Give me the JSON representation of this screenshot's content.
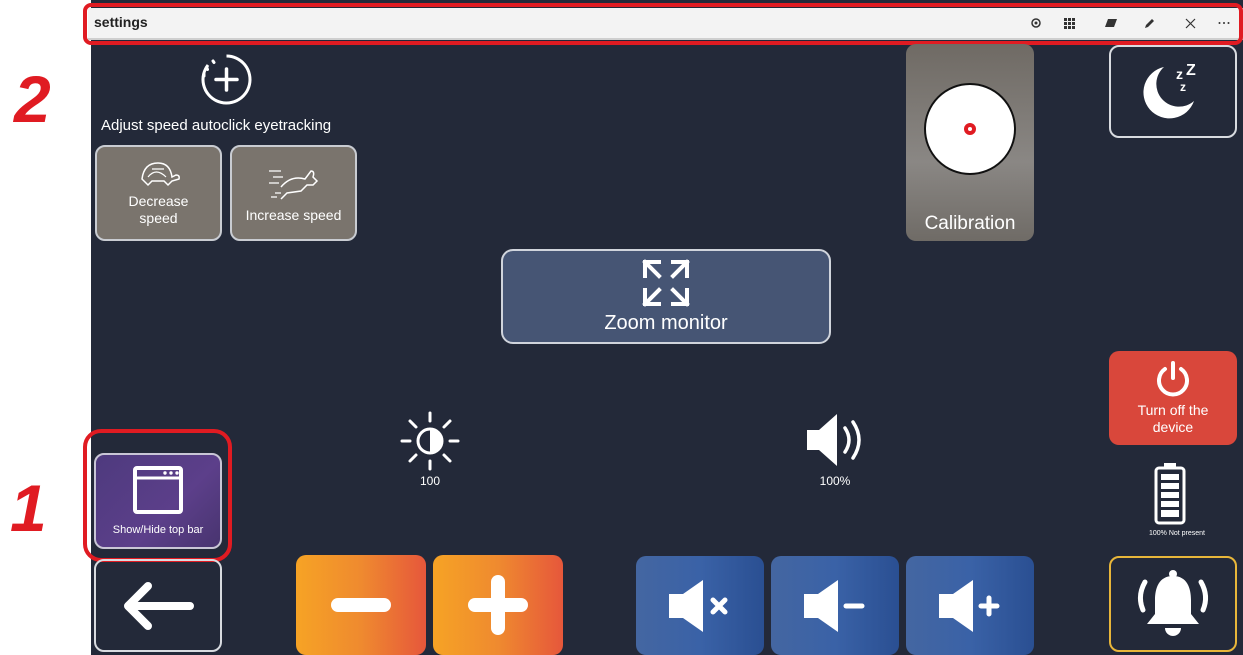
{
  "window": {
    "title": "settings"
  },
  "annotations": {
    "marker_1": "1",
    "marker_2": "2"
  },
  "speed": {
    "heading": "Adjust speed autoclick eyetracking",
    "decrease_label_line1": "Decrease",
    "decrease_label_line2": "speed",
    "increase_label": "Increase speed"
  },
  "calibration": {
    "label": "Calibration"
  },
  "zoom": {
    "label": "Zoom monitor"
  },
  "brightness": {
    "value": "100"
  },
  "volume": {
    "value": "100%"
  },
  "power": {
    "label_line1": "Turn off the",
    "label_line2": "device"
  },
  "battery": {
    "status": "100% Not present",
    "level": 1.0
  },
  "topbar_toggle": {
    "label": "Show/Hide top bar"
  },
  "colors": {
    "background": "#232939",
    "orange": "#f09a2a",
    "blue": "#3a62a7",
    "power_red": "#d9473b",
    "alarm_border": "#e8b63a",
    "annotation_red": "#e01b22"
  },
  "icons": [
    "settings-gear-icon",
    "apps-grid-icon",
    "eraser-icon",
    "pen-icon",
    "close-icon",
    "more-icon",
    "plus-circle-icon",
    "turtle-icon",
    "rabbit-icon",
    "calibration-target-icon",
    "sleep-moon-icon",
    "zoom-expand-icon",
    "brightness-icon",
    "volume-icon",
    "power-icon",
    "battery-icon",
    "window-icon",
    "back-arrow-icon",
    "minus-icon",
    "plus-icon",
    "mute-icon",
    "volume-down-icon",
    "volume-up-icon",
    "alarm-bell-icon"
  ]
}
